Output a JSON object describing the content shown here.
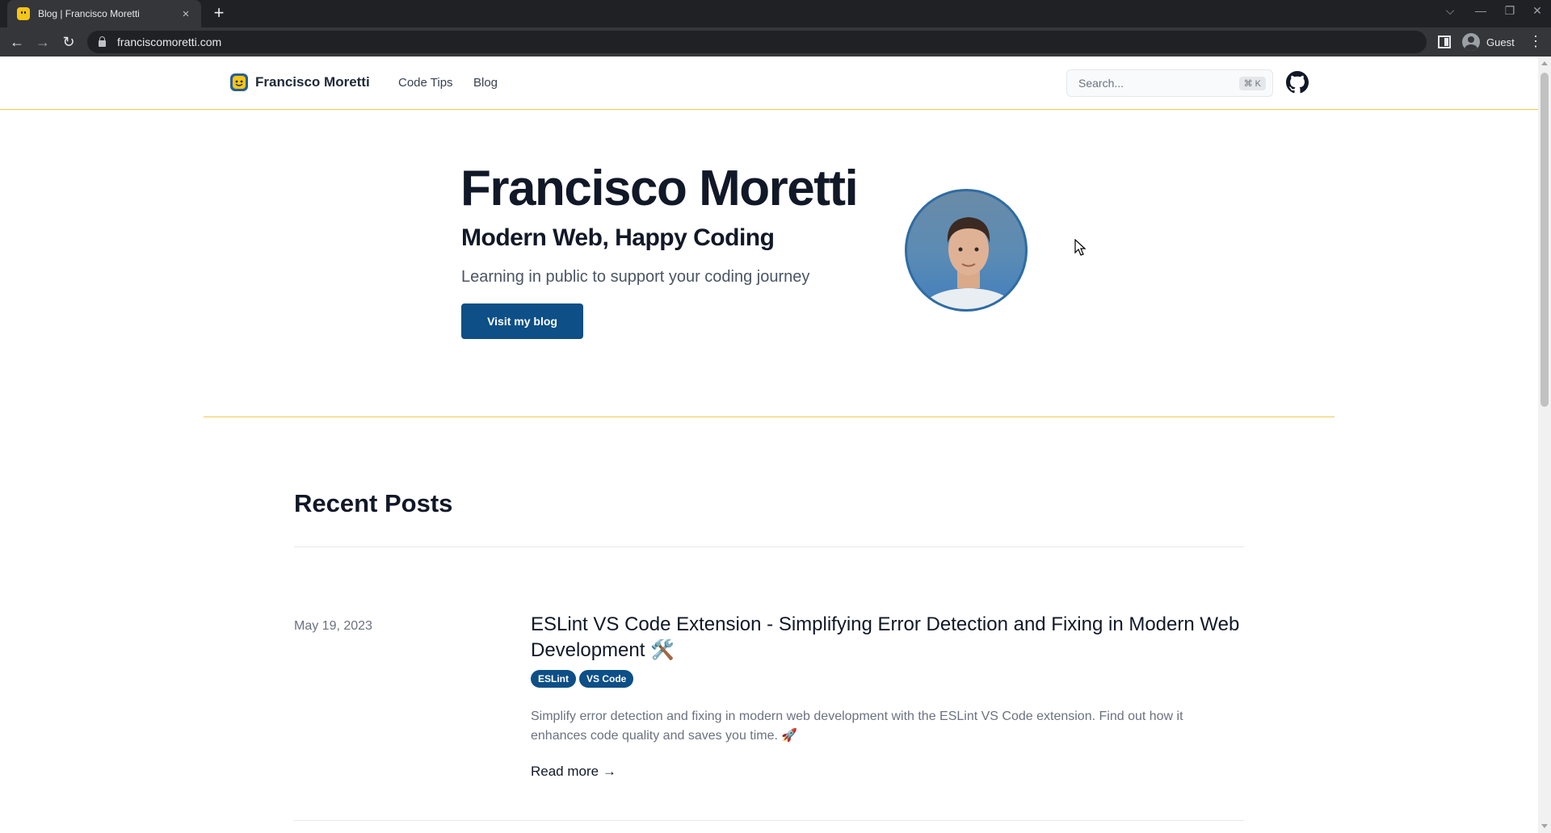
{
  "browser": {
    "tab_title": "Blog | Francisco Moretti",
    "tab_close": "×",
    "new_tab": "+",
    "url": "franciscomoretti.com",
    "profile_name": "Guest",
    "back": "←",
    "forward": "→",
    "reload": "↻",
    "menu": "⋮",
    "win_chevron": "⌵",
    "win_minimize": "—",
    "win_restore": "❐",
    "win_close": "✕"
  },
  "site": {
    "brand_name": "Francisco Moretti",
    "nav": [
      {
        "label": "Code Tips"
      },
      {
        "label": "Blog"
      }
    ],
    "search_placeholder": "Search...",
    "search_shortcut": "⌘ K"
  },
  "hero": {
    "name": "Francisco Moretti",
    "subtitle": "Modern Web, Happy Coding",
    "tagline": "Learning in public to support your coding journey",
    "cta": "Visit my blog"
  },
  "recent": {
    "title": "Recent Posts",
    "posts": [
      {
        "date": "May 19, 2023",
        "title": "ESLint VS Code Extension - Simplifying Error Detection and Fixing in Modern Web Development 🛠️",
        "tags": [
          "ESLint",
          "VS Code"
        ],
        "excerpt": "Simplify error detection and fixing in modern web development with the ESLint VS Code extension. Find out how it enhances code quality and saves you time. 🚀",
        "read_more": "Read more →"
      }
    ]
  },
  "colors": {
    "accent": "#0d4f86",
    "header_border": "#f2c94c",
    "chrome_dark": "#202124",
    "chrome_mid": "#35363a"
  }
}
